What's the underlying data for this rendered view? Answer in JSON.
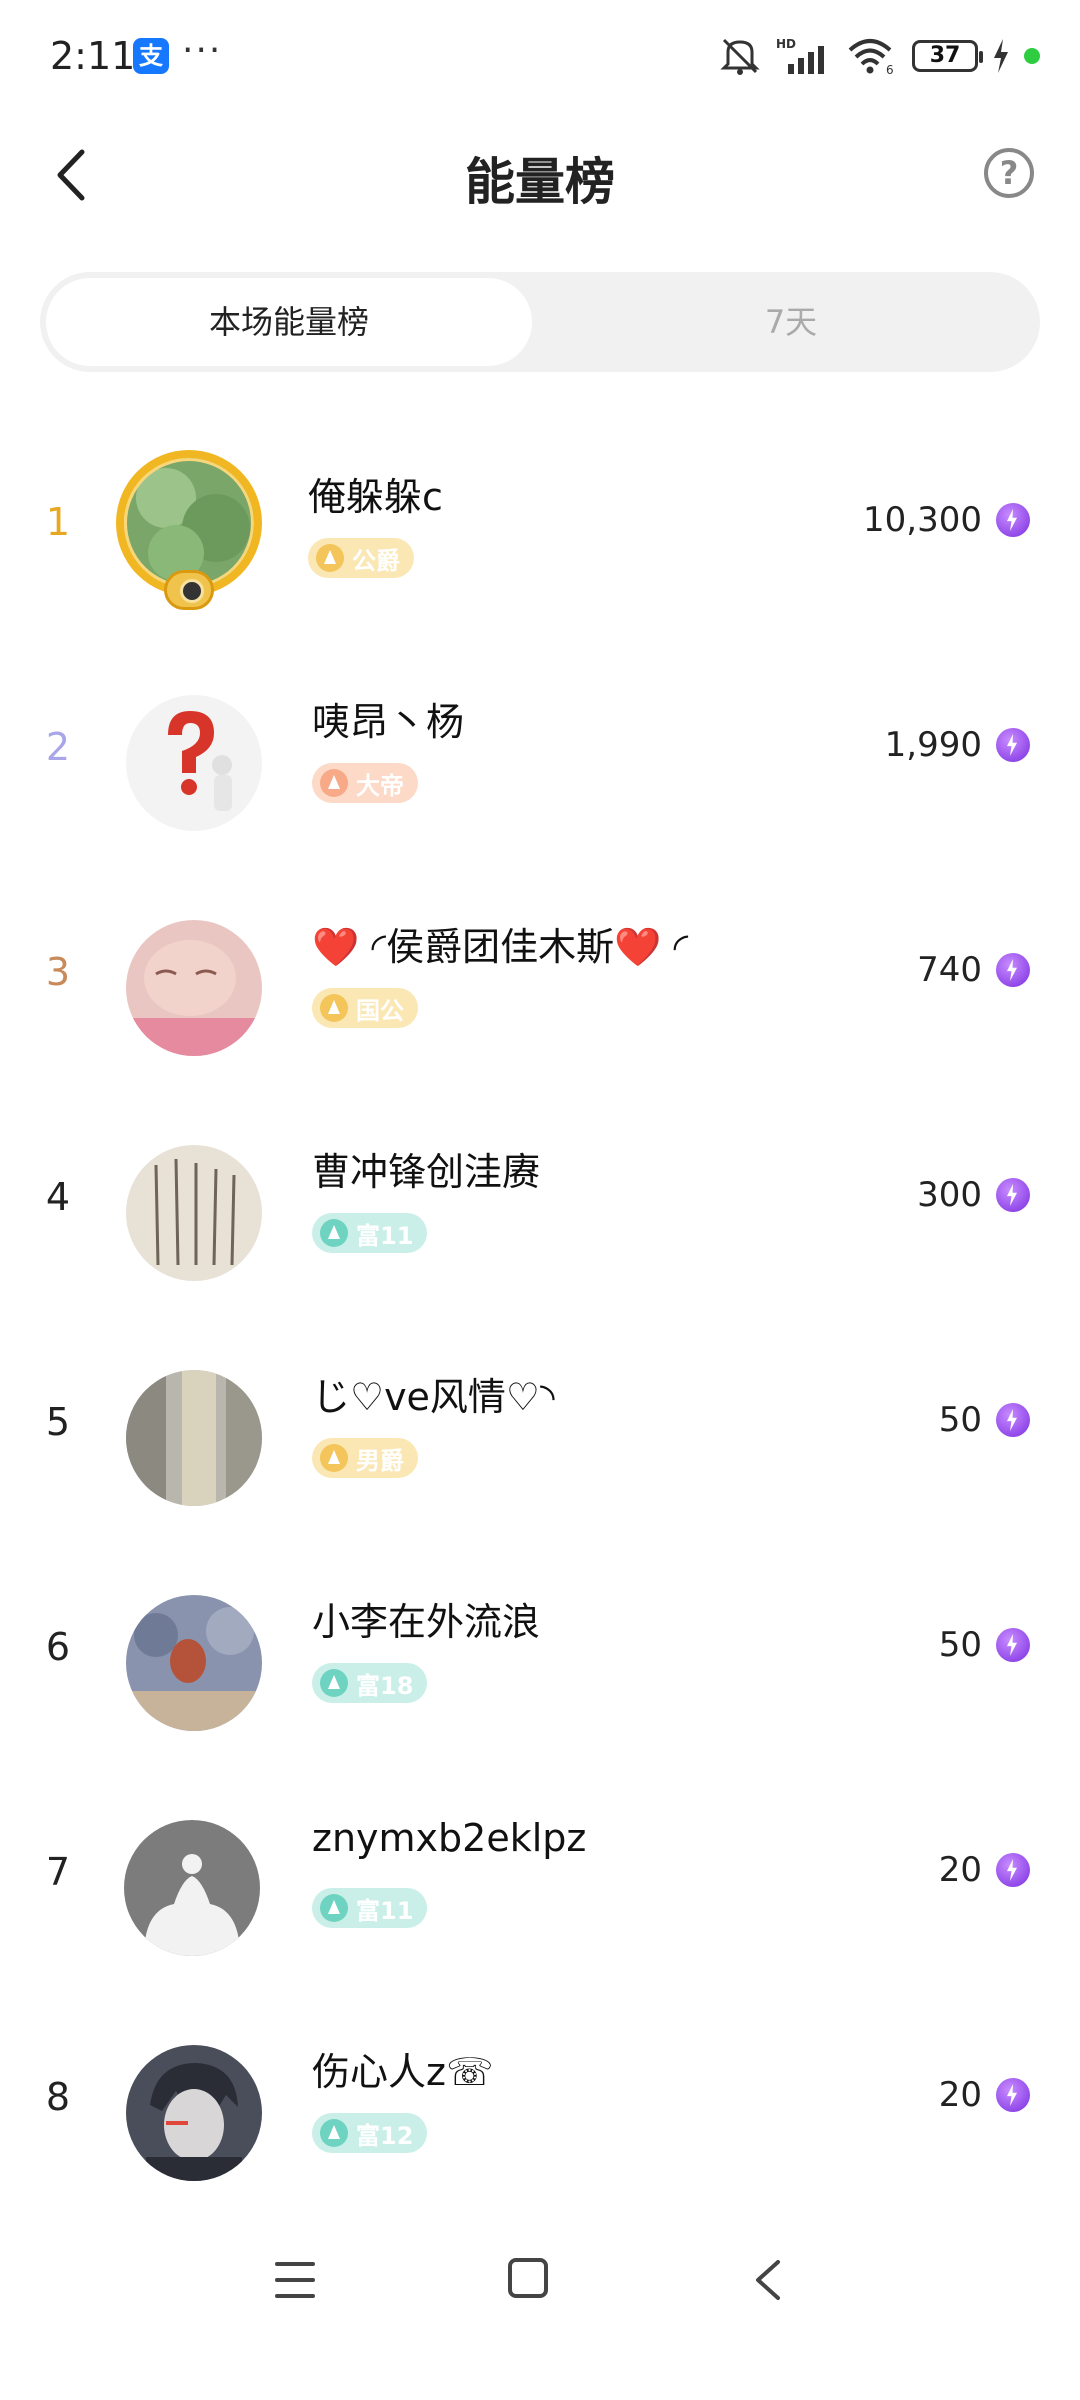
{
  "status_bar": {
    "time": "2:11",
    "app_icon_glyph": "支",
    "more": "···",
    "network_label": "HD",
    "wifi_label": "6",
    "battery": "37"
  },
  "header": {
    "title": "能量榜",
    "back_icon": "chevron-left-icon",
    "help_icon": "question-circle-icon",
    "help_glyph": "?"
  },
  "tabs": [
    {
      "label": "本场能量榜",
      "active": true
    },
    {
      "label": "7天",
      "active": false
    }
  ],
  "ranking": [
    {
      "rank": "1",
      "name": "俺躲躲c",
      "badge": "公爵",
      "badge_style": "gold",
      "score": "10,300"
    },
    {
      "rank": "2",
      "name": "咦昂丶杨",
      "badge": "大帝",
      "badge_style": "orange",
      "score": "1,990"
    },
    {
      "rank": "3",
      "name": "❤️ ◜侯爵团佳木斯❤️ ◜",
      "badge": "国公",
      "badge_style": "gold",
      "score": "740"
    },
    {
      "rank": "4",
      "name": "曹冲锋创洼赓",
      "badge": "富11",
      "badge_style": "teal",
      "score": "300"
    },
    {
      "rank": "5",
      "name": "じ♡ve风情♡◝",
      "badge": "男爵",
      "badge_style": "gold",
      "score": "50"
    },
    {
      "rank": "6",
      "name": "小李在外流浪",
      "badge": "富18",
      "badge_style": "teal",
      "score": "50"
    },
    {
      "rank": "7",
      "name": "znymxb2eklpz",
      "badge": "富11",
      "badge_style": "teal",
      "score": "20"
    },
    {
      "rank": "8",
      "name": "伤心人z☏",
      "badge": "富12",
      "badge_style": "teal",
      "score": "20"
    }
  ],
  "colors": {
    "rank1": "#e5a820",
    "rank2": "#a8a6e8",
    "rank3": "#c88a5a",
    "energy": "#7a2ee0"
  },
  "nav_bar": {
    "menu_icon": "menu-icon",
    "home_icon": "home-square-icon",
    "back_icon": "back-triangle-icon"
  }
}
